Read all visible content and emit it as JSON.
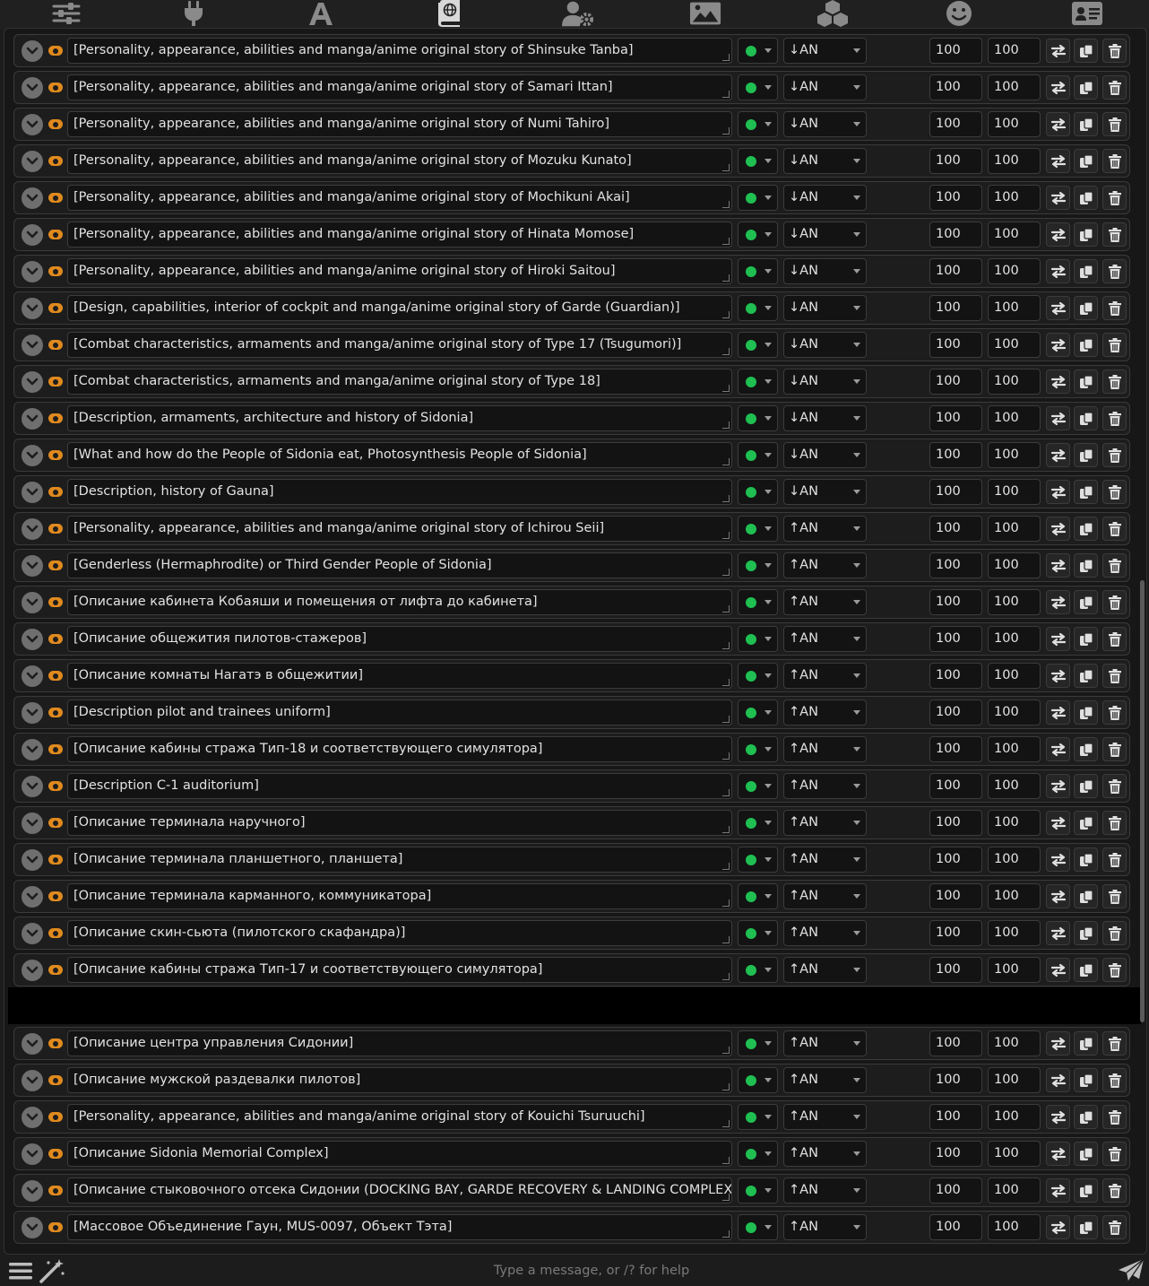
{
  "top_nav": [
    {
      "name": "sliders-icon"
    },
    {
      "name": "plug-icon"
    },
    {
      "name": "font-a-icon"
    },
    {
      "name": "book-globe-icon",
      "active": true
    },
    {
      "name": "user-gear-icon"
    },
    {
      "name": "image-icon"
    },
    {
      "name": "cubes-icon"
    },
    {
      "name": "smile-icon"
    },
    {
      "name": "id-card-icon"
    }
  ],
  "entries": [
    {
      "title": "[Personality, appearance, abilities and manga/anime original story of Shinsuke Tanba]",
      "position": "↓AN",
      "depth": "100",
      "order": "100"
    },
    {
      "title": "[Personality, appearance, abilities and manga/anime original story of Samari Ittan]",
      "position": "↓AN",
      "depth": "100",
      "order": "100"
    },
    {
      "title": "[Personality, appearance, abilities and manga/anime original story of Numi Tahiro]",
      "position": "↓AN",
      "depth": "100",
      "order": "100"
    },
    {
      "title": "[Personality, appearance, abilities and manga/anime original story of Mozuku Kunato]",
      "position": "↓AN",
      "depth": "100",
      "order": "100"
    },
    {
      "title": "[Personality, appearance, abilities and manga/anime original story of Mochikuni Akai]",
      "position": "↓AN",
      "depth": "100",
      "order": "100"
    },
    {
      "title": "[Personality, appearance, abilities and manga/anime original story of Hinata Momose]",
      "position": "↓AN",
      "depth": "100",
      "order": "100"
    },
    {
      "title": "[Personality, appearance, abilities and manga/anime original story of Hiroki Saitou]",
      "position": "↓AN",
      "depth": "100",
      "order": "100"
    },
    {
      "title": "[Design, capabilities, interior of cockpit and manga/anime original story of Garde (Guardian)]",
      "position": "↓AN",
      "depth": "100",
      "order": "100"
    },
    {
      "title": "[Combat characteristics, armaments and manga/anime original story of Type 17 (Tsugumori)]",
      "position": "↓AN",
      "depth": "100",
      "order": "100"
    },
    {
      "title": "[Combat characteristics, armaments and manga/anime original story of Type 18]",
      "position": "↓AN",
      "depth": "100",
      "order": "100"
    },
    {
      "title": "[Description, armaments, architecture and history of Sidonia]",
      "position": "↓AN",
      "depth": "100",
      "order": "100"
    },
    {
      "title": "[What and how do the People of Sidonia eat, Photosynthesis People of Sidonia]",
      "position": "↓AN",
      "depth": "100",
      "order": "100"
    },
    {
      "title": "[Description, history of Gauna]",
      "position": "↓AN",
      "depth": "100",
      "order": "100"
    },
    {
      "title": "[Personality, appearance, abilities and manga/anime original story of Ichirou Seii]",
      "position": "↑AN",
      "depth": "100",
      "order": "100"
    },
    {
      "title": "[Genderless (Hermaphrodite) or Third Gender People of Sidonia]",
      "position": "↑AN",
      "depth": "100",
      "order": "100"
    },
    {
      "title": "[Описание кабинета Кобаяши и помещения от лифта до кабинета]",
      "position": "↑AN",
      "depth": "100",
      "order": "100"
    },
    {
      "title": "[Описание общежития пилотов-стажеров]",
      "position": "↑AN",
      "depth": "100",
      "order": "100"
    },
    {
      "title": "[Описание комнаты Нагатэ в общежитии]",
      "position": "↑AN",
      "depth": "100",
      "order": "100"
    },
    {
      "title": "[Description pilot and trainees uniform]",
      "position": "↑AN",
      "depth": "100",
      "order": "100"
    },
    {
      "title": "[Описание кабины стража Тип-18 и соответствующего симулятора]",
      "position": "↑AN",
      "depth": "100",
      "order": "100"
    },
    {
      "title": "[Description C-1 auditorium]",
      "position": "↑AN",
      "depth": "100",
      "order": "100"
    },
    {
      "title": "[Описание терминала наручного]",
      "position": "↑AN",
      "depth": "100",
      "order": "100"
    },
    {
      "title": "[Описание терминала планшетного, планшета]",
      "position": "↑AN",
      "depth": "100",
      "order": "100"
    },
    {
      "title": "[Описание терминала карманного, коммуникатора]",
      "position": "↑AN",
      "depth": "100",
      "order": "100"
    },
    {
      "title": "[Описание скин-сьюта (пилотского скафандра)]",
      "position": "↑AN",
      "depth": "100",
      "order": "100"
    },
    {
      "title": "[Описание кабины стража Тип-17 и соответствующего симулятора]",
      "position": "↑AN",
      "depth": "100",
      "order": "100"
    },
    {
      "title": "[Описание центра управления Сидонии]",
      "position": "↑AN",
      "depth": "100",
      "order": "100"
    },
    {
      "title": "[Описание мужской раздевалки пилотов]",
      "position": "↑AN",
      "depth": "100",
      "order": "100"
    },
    {
      "title": "[Personality, appearance, abilities and manga/anime original story of Kouichi Tsuruuchi]",
      "position": "↑AN",
      "depth": "100",
      "order": "100"
    },
    {
      "title": "[Описание Sidonia Memorial Complex]",
      "position": "↑AN",
      "depth": "100",
      "order": "100"
    },
    {
      "title": "[Описание стыковочного отсека Сидонии (DOCKING BAY, GARDE RECOVERY & LANDING COMPLEX)]",
      "position": "↑AN",
      "depth": "100",
      "order": "100"
    },
    {
      "title": "[Массовое Объединение Гаун, MUS-0097, Объект Тэта]",
      "position": "↑AN",
      "depth": "100",
      "order": "100"
    }
  ],
  "colors": {
    "toggle_on": "#e08a1e",
    "status_green": "#1fbf52",
    "background": "#171717"
  },
  "chat": {
    "placeholder": "Type a message, or /? for help"
  }
}
